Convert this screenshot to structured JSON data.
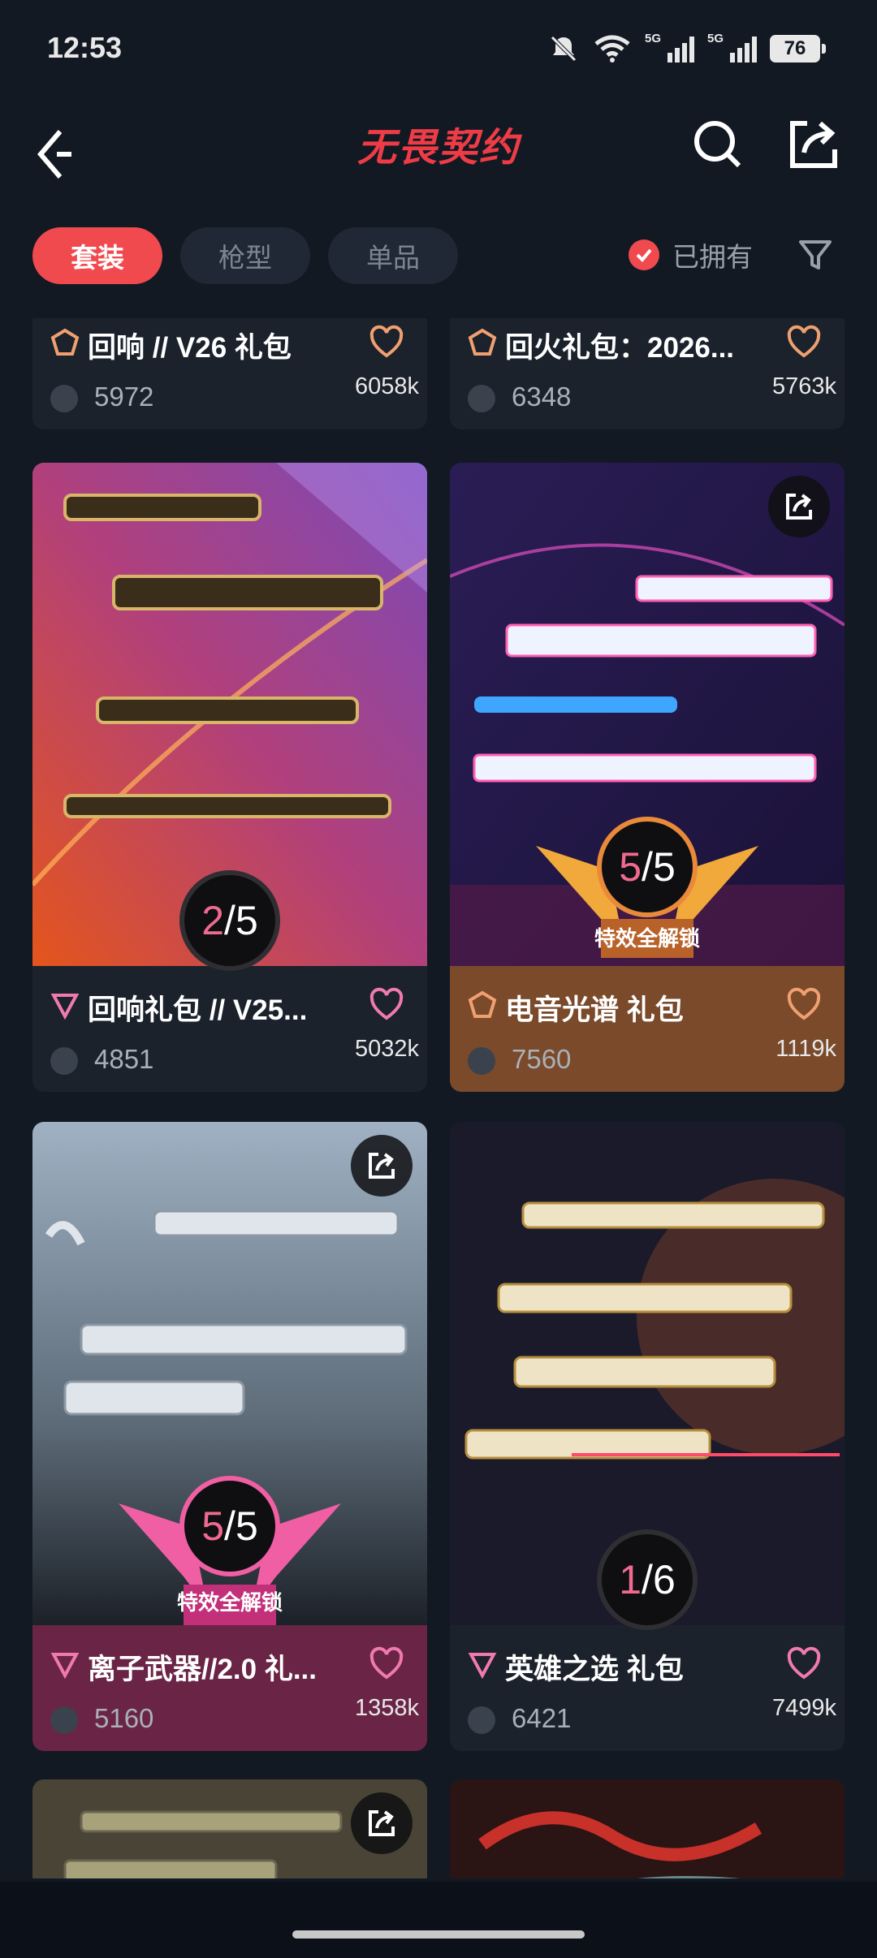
{
  "status": {
    "time": "12:53",
    "net1": "5G",
    "net2": "5G",
    "battery": "76"
  },
  "header": {
    "title": "无畏契约"
  },
  "filters": {
    "tabs": [
      "套装",
      "枪型",
      "单品"
    ],
    "owned_label": "已拥有"
  },
  "cards": [
    {
      "title": "回响 // V26 礼包",
      "price": "5972",
      "likes": "6058k"
    },
    {
      "title": "回火礼包：2026...",
      "price": "6348",
      "likes": "5763k"
    },
    {
      "title": "回响礼包 // V25...",
      "price": "4851",
      "likes": "5032k",
      "progress": "2/5",
      "progress_cur": "2",
      "progress_total": "5"
    },
    {
      "title": "电音光谱 礼包",
      "price": "7560",
      "likes": "1119k",
      "progress": "5/5",
      "progress_cur": "5",
      "progress_total": "5",
      "unlock_label": "特效全解锁"
    },
    {
      "title": "离子武器//2.0 礼...",
      "price": "5160",
      "likes": "1358k",
      "progress": "5/5",
      "progress_cur": "5",
      "progress_total": "5",
      "unlock_label": "特效全解锁"
    },
    {
      "title": "英雄之选 礼包",
      "price": "6421",
      "likes": "7499k",
      "progress": "1/6",
      "progress_cur": "1",
      "progress_total": "6"
    }
  ],
  "colors": {
    "accent": "#f04a4f",
    "heart": "#f0a070",
    "heart_pink": "#f07ab0",
    "background": "#121923"
  }
}
